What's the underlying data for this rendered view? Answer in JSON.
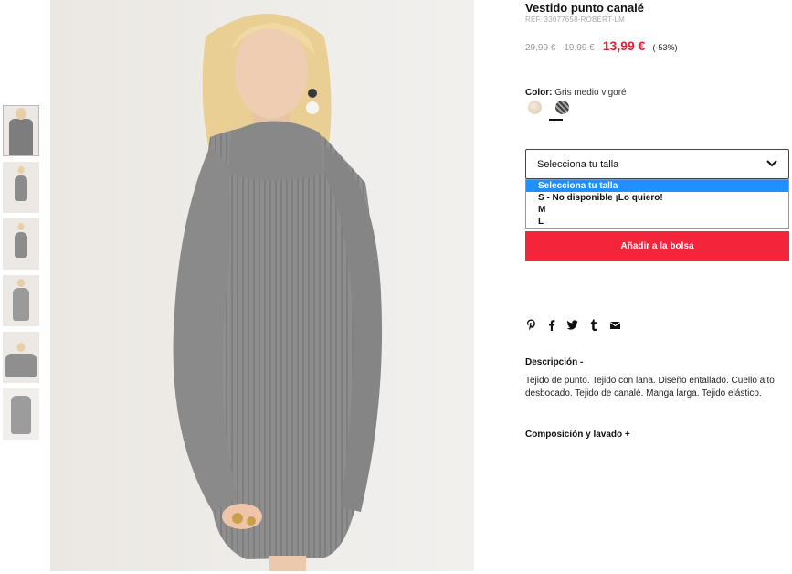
{
  "product": {
    "title": "Vestido punto canalé",
    "ref": "REF. 33077658-ROBERT-LM",
    "price_original": "29,99 €",
    "price_previous": "19,99 €",
    "price_sale": "13,99 €",
    "discount": "(-53%)"
  },
  "color": {
    "label": "Color:",
    "value": "Gris medio vigoré",
    "swatches": [
      "beige",
      "gris medio vigoré"
    ]
  },
  "size": {
    "select_label": "Selecciona tu talla",
    "options": [
      "Selecciona tu talla",
      "S - No disponible ¡Lo quiero!",
      "M",
      "L"
    ],
    "selected_index": 0
  },
  "cart": {
    "add_label": "Añadir a la bolsa"
  },
  "share": {
    "icons": [
      "pinterest-icon",
      "facebook-icon",
      "twitter-icon",
      "tumblr-icon",
      "mail-icon"
    ]
  },
  "description": {
    "heading": "Descripción -",
    "text": "Tejido de punto. Tejido con lana. Diseño entallado. Cuello alto desbocado. Tejido de canalé. Manga larga. Tejido elástico."
  },
  "composition": {
    "heading": "Composición y lavado +"
  },
  "colors": {
    "accent": "#f4253a",
    "sale": "#e4212f",
    "dropdown_highlight": "#1e90ff"
  }
}
